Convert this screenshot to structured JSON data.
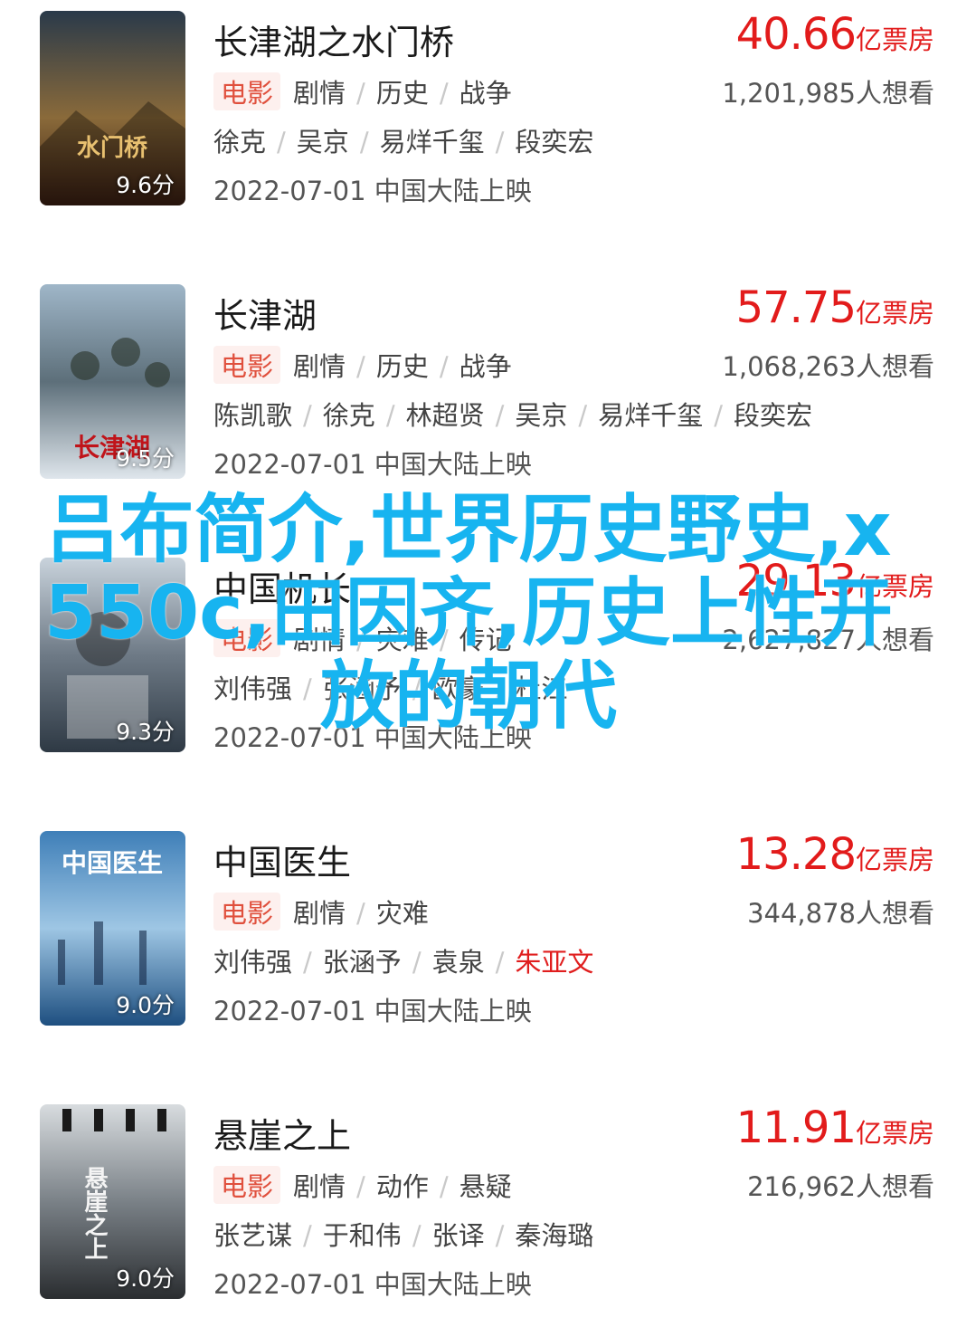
{
  "movies": [
    {
      "title": "长津湖之水门桥",
      "tag": "电影",
      "genres": [
        "剧情",
        "历史",
        "战争"
      ],
      "cast": [
        "徐克",
        "吴京",
        "易烊千玺",
        "段奕宏"
      ],
      "date": "2022-07-01 中国大陆上映",
      "score": "9.6分",
      "box_office": "40.66",
      "box_unit": "亿票房",
      "wants": "1,201,985人想看",
      "poster_text": "水门桥",
      "colors": {
        "top": "#2a3a4a",
        "mid": "#8a6a3a",
        "bottom": "#3a1e12"
      }
    },
    {
      "title": "长津湖",
      "tag": "电影",
      "genres": [
        "剧情",
        "历史",
        "战争"
      ],
      "cast": [
        "陈凯歌",
        "徐克",
        "林超贤",
        "吴京",
        "易烊千玺",
        "段奕宏"
      ],
      "date": "2022-07-01 中国大陆上映",
      "score": "9.5分",
      "box_office": "57.75",
      "box_unit": "亿票房",
      "wants": "1,068,263人想看",
      "poster_text": "长津湖",
      "colors": {
        "top": "#9fb6c8",
        "mid": "#5d6f7a",
        "bottom": "#dfe6ec"
      }
    },
    {
      "title": "中国机长",
      "tag": "电影",
      "genres": [
        "剧情",
        "灾难",
        "传记"
      ],
      "cast": [
        "刘伟强",
        "张涵予",
        "欧豪",
        "杜江"
      ],
      "date": "2022-07-01 中国大陆上映",
      "score": "9.3分",
      "box_office": "29.13",
      "box_unit": "亿票房",
      "wants": "2,627,827人想看",
      "poster_text": "",
      "colors": {
        "top": "#c9d3dc",
        "mid": "#6e7a86",
        "bottom": "#2e3944"
      }
    },
    {
      "title": "中国医生",
      "tag": "电影",
      "genres": [
        "剧情",
        "灾难"
      ],
      "cast": [
        "刘伟强",
        "张涵予",
        "袁泉",
        "朱亚文"
      ],
      "date": "2022-07-01 中国大陆上映",
      "score": "9.0分",
      "box_office": "13.28",
      "box_unit": "亿票房",
      "wants": "344,878人想看",
      "poster_text": "中国医生",
      "colors": {
        "top": "#3f7fb8",
        "mid": "#9ec6e4",
        "bottom": "#1e4f80"
      }
    },
    {
      "title": "悬崖之上",
      "tag": "电影",
      "genres": [
        "剧情",
        "动作",
        "悬疑"
      ],
      "cast": [
        "张艺谋",
        "于和伟",
        "张译",
        "秦海璐"
      ],
      "date": "2022-07-01 中国大陆上映",
      "score": "9.0分",
      "box_office": "11.91",
      "box_unit": "亿票房",
      "wants": "216,962人想看",
      "poster_text": "悬崖之上",
      "colors": {
        "top": "#d8dcdf",
        "mid": "#7a8187",
        "bottom": "#2a2d30"
      }
    }
  ],
  "overlay_text": "吕布简介,世界历史野史,x550c,田因齐,历史上性开放的朝代"
}
